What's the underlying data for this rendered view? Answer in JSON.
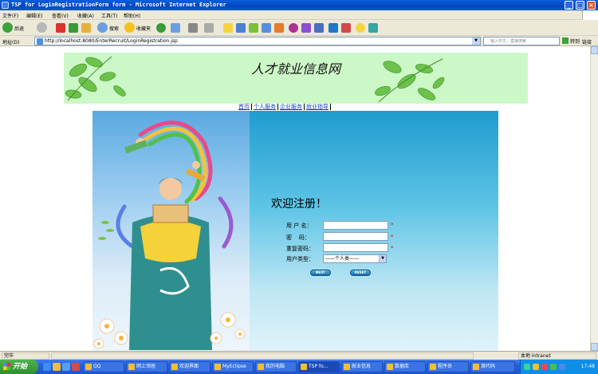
{
  "window": {
    "title": "TSP for LoginRegistrationForm form - Microsoft Internet Explorer",
    "minimize": "_",
    "maximize": "□",
    "close": "×"
  },
  "menu": [
    "文件(F)",
    "编辑(E)",
    "查看(V)",
    "收藏(A)",
    "工具(T)",
    "帮助(H)"
  ],
  "toolbar": {
    "back_label": "后退",
    "search_label": "搜索",
    "favorites_label": "收藏夹"
  },
  "address": {
    "label": "地址(D)",
    "url": "http://localhost:8080/EnterRecruit/LoginRegistration.jsp",
    "search_placeholder": "输入中文，直接搜索",
    "go_label": "转到",
    "links_label": "链接"
  },
  "page": {
    "site_title": "人才就业信息网",
    "nav": [
      "首页",
      "个人服务",
      "企业服务",
      "就业指导"
    ],
    "welcome": "欢迎注册！",
    "fields": {
      "username_label": "用 户 名：",
      "password_label": "密    码：",
      "confirm_label": "重复密码：",
      "usertype_label": "用户类型：",
      "required_mark": "*",
      "usertype_value": "——个人类——"
    },
    "buttons": {
      "next": "NEXT",
      "reset": "RESET"
    }
  },
  "status": {
    "left": "完毕",
    "zone": "本地 Intranet"
  },
  "taskbar": {
    "start": "开始",
    "tasks": [
      "QQ",
      "网上邻居",
      "欢迎界面",
      "MyEclipse",
      "我的电脑",
      "TSP fo...",
      "就业信息",
      "数据库",
      "程序员",
      "源代码"
    ],
    "active_index": 5,
    "clock": "17:48"
  },
  "colors": {
    "titlebar": "#0a5fd8",
    "banner_bg": "#ccf7c6",
    "nav_link": "#2233cc",
    "form_top": "#1f9ccf",
    "required": "#dd0000",
    "taskbar": "#245edb",
    "start_button": "#3a9a3a"
  }
}
